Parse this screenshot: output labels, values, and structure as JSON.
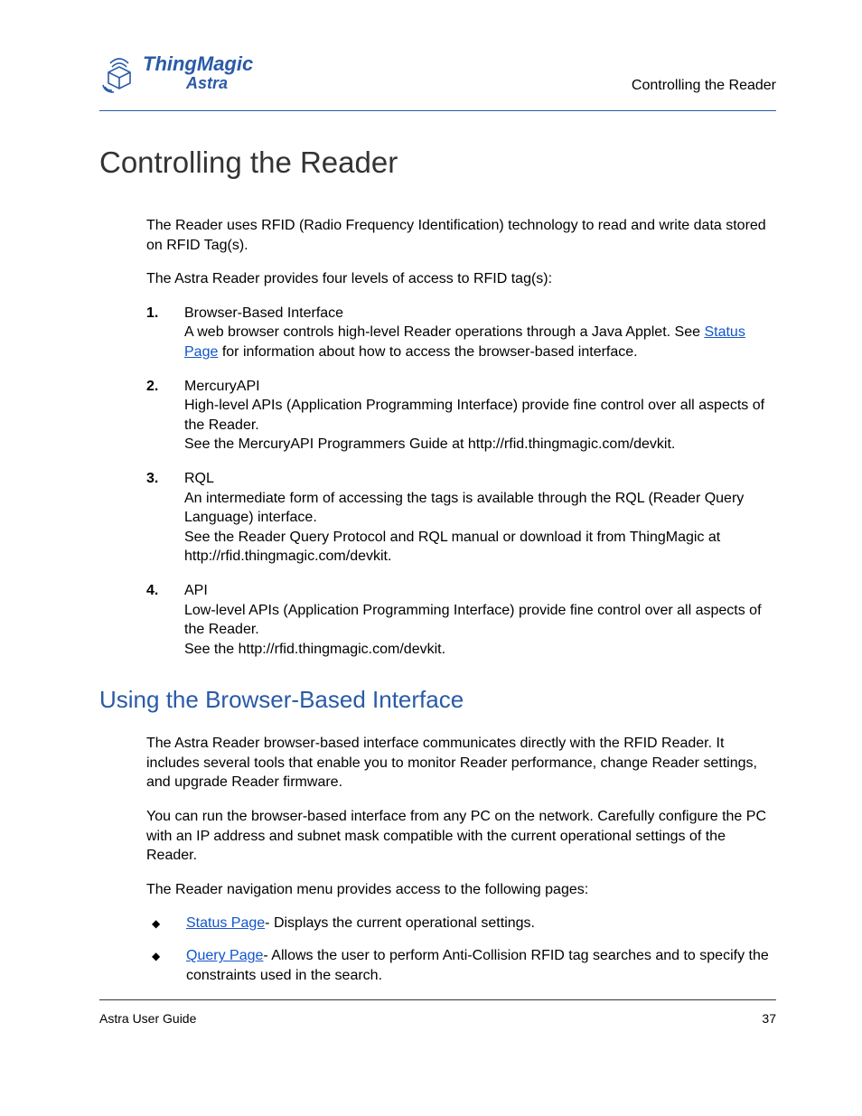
{
  "header": {
    "logo_main": "ThingMagic",
    "logo_sub": "Astra",
    "right": "Controlling the Reader"
  },
  "title": "Controlling the Reader",
  "intro_p1": "The Reader uses RFID (Radio Frequency Identification) technology to read and write data stored on RFID Tag(s).",
  "intro_p2": "The Astra Reader provides four levels of access to RFID tag(s):",
  "list": [
    {
      "num": "1.",
      "title": "Browser-Based Interface",
      "line1_pre": "A web browser controls high-level Reader operations through a Java Applet. See ",
      "link": "Status Page",
      "line1_post": " for information about how to access the browser-based interface."
    },
    {
      "num": "2.",
      "title": "MercuryAPI",
      "body": "High-level APIs (Application Programming Interface) provide fine control over all aspects of the Reader.\nSee the MercuryAPI Programmers Guide at http://rfid.thingmagic.com/devkit."
    },
    {
      "num": "3.",
      "title": "RQL",
      "body": "An intermediate form of accessing the tags is available through the RQL (Reader Query Language) interface.\nSee the Reader Query Protocol and RQL manual or download it from ThingMagic at http://rfid.thingmagic.com/devkit."
    },
    {
      "num": "4.",
      "title": "API",
      "body": "Low-level APIs (Application Programming Interface) provide fine control over all aspects of the Reader.\nSee the http://rfid.thingmagic.com/devkit."
    }
  ],
  "section2": {
    "title": "Using the Browser-Based Interface",
    "p1": "The Astra Reader browser-based interface communicates directly with the RFID Reader. It includes several tools that enable you to monitor Reader performance, change Reader settings, and upgrade Reader firmware.",
    "p2": "You can run the browser-based interface from any PC on the network. Carefully configure the PC with an IP address and subnet mask compatible with the current operational settings of the Reader.",
    "p3": "The Reader navigation menu provides access to the following pages:",
    "bullets": [
      {
        "link": "Status Page",
        "rest": "- Displays the current operational settings."
      },
      {
        "link": "Query Page",
        "rest": "- Allows the user to perform Anti-Collision RFID tag searches and to specify the constraints used in the search."
      }
    ]
  },
  "footer": {
    "left": "Astra User Guide",
    "right": "37"
  }
}
